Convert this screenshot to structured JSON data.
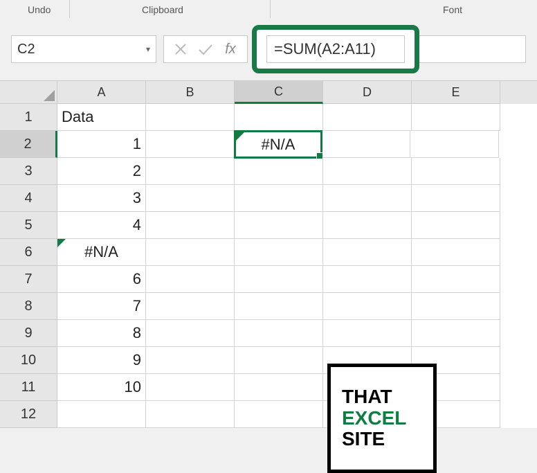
{
  "ribbon": {
    "undo": "Undo",
    "clipboard": "Clipboard",
    "font": "Font"
  },
  "nameBox": {
    "value": "C2"
  },
  "formula": {
    "value": "=SUM(A2:A11)",
    "fxLabel": "fx"
  },
  "columns": [
    "A",
    "B",
    "C",
    "D",
    "E"
  ],
  "activeCol": 2,
  "activeRow": 2,
  "rows": [
    {
      "n": "1",
      "a": "Data",
      "aAlign": "txt",
      "c": ""
    },
    {
      "n": "2",
      "a": "1",
      "aAlign": "num",
      "c": "#N/A",
      "cSel": true,
      "cErr": true
    },
    {
      "n": "3",
      "a": "2",
      "aAlign": "num",
      "c": ""
    },
    {
      "n": "4",
      "a": "3",
      "aAlign": "num",
      "c": ""
    },
    {
      "n": "5",
      "a": "4",
      "aAlign": "num",
      "c": ""
    },
    {
      "n": "6",
      "a": "#N/A",
      "aAlign": "ctr",
      "aErr": true,
      "c": ""
    },
    {
      "n": "7",
      "a": "6",
      "aAlign": "num",
      "c": ""
    },
    {
      "n": "8",
      "a": "7",
      "aAlign": "num",
      "c": ""
    },
    {
      "n": "9",
      "a": "8",
      "aAlign": "num",
      "c": ""
    },
    {
      "n": "10",
      "a": "9",
      "aAlign": "num",
      "c": ""
    },
    {
      "n": "11",
      "a": "10",
      "aAlign": "num",
      "c": ""
    },
    {
      "n": "12",
      "a": "",
      "aAlign": "num",
      "c": ""
    }
  ],
  "logo": {
    "line1": "THAT",
    "line2": "EXCEL",
    "line3": "SITE"
  }
}
